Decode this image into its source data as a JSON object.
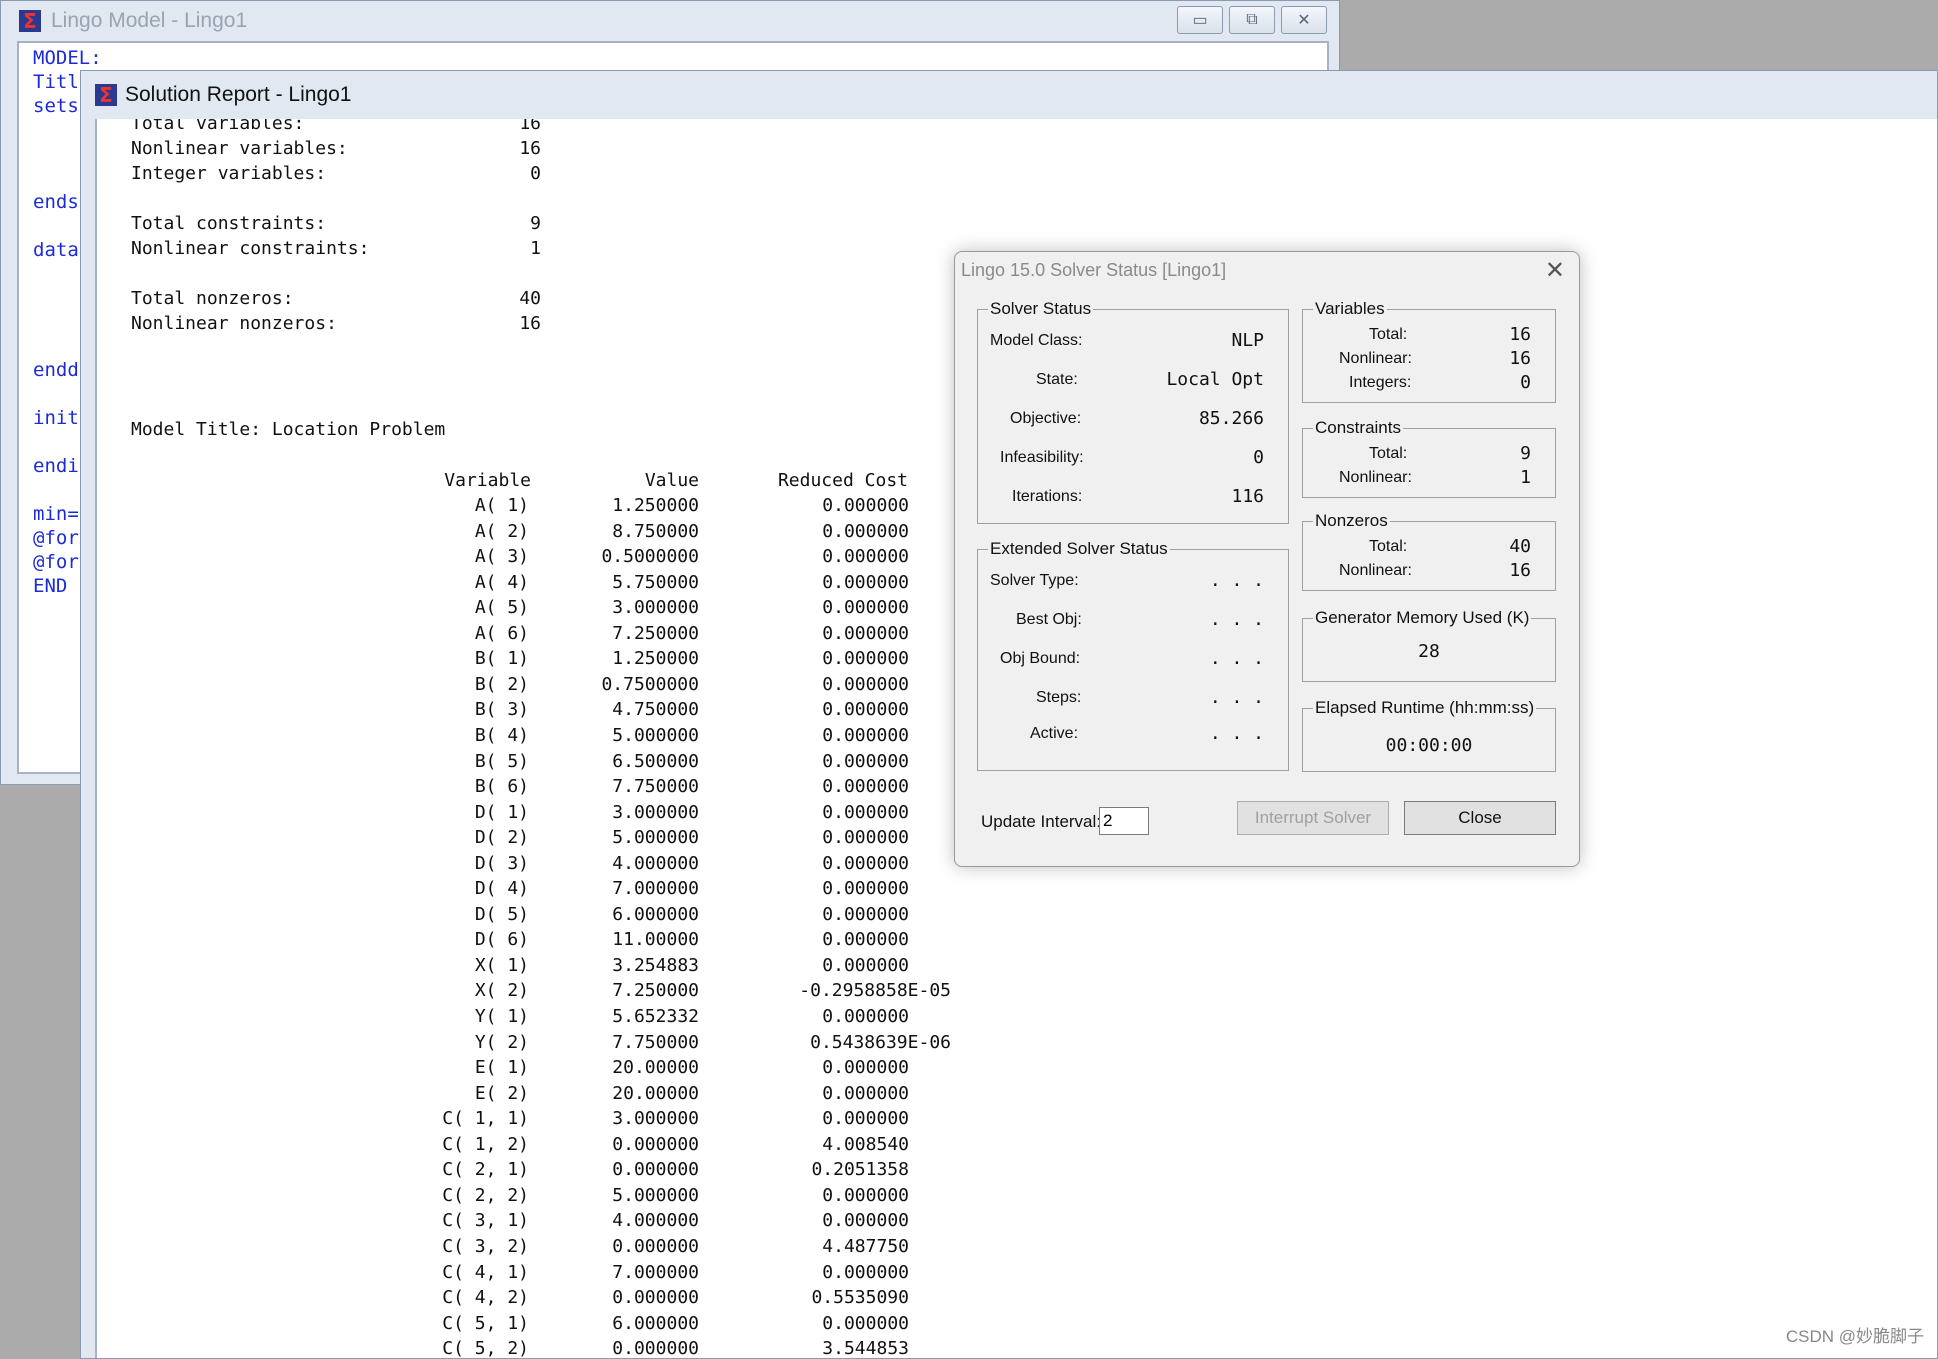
{
  "model_window": {
    "title": "Lingo Model - Lingo1",
    "code_lines": [
      "MODEL:",
      "Titl",
      "sets",
      "ends",
      "data",
      "endd",
      "init",
      "endi",
      "min=",
      "@for",
      "@for",
      "END"
    ]
  },
  "report_window": {
    "title": "Solution Report - Lingo1",
    "stats": [
      {
        "label": "Total variables:",
        "value": "16"
      },
      {
        "label": "Nonlinear variables:",
        "value": "16"
      },
      {
        "label": "Integer variables:",
        "value": "0"
      },
      {
        "label": "Total constraints:",
        "value": "9"
      },
      {
        "label": "Nonlinear constraints:",
        "value": "1"
      },
      {
        "label": "Total nonzeros:",
        "value": "40"
      },
      {
        "label": "Nonlinear nonzeros:",
        "value": "16"
      }
    ],
    "model_title_line": "Model Title: Location Problem",
    "table_headers": {
      "variable": "Variable",
      "value": "Value",
      "reduced_cost": "Reduced Cost"
    },
    "rows": [
      [
        "A( 1)",
        "1.250000",
        "0.000000"
      ],
      [
        "A( 2)",
        "8.750000",
        "0.000000"
      ],
      [
        "A( 3)",
        "0.5000000",
        "0.000000"
      ],
      [
        "A( 4)",
        "5.750000",
        "0.000000"
      ],
      [
        "A( 5)",
        "3.000000",
        "0.000000"
      ],
      [
        "A( 6)",
        "7.250000",
        "0.000000"
      ],
      [
        "B( 1)",
        "1.250000",
        "0.000000"
      ],
      [
        "B( 2)",
        "0.7500000",
        "0.000000"
      ],
      [
        "B( 3)",
        "4.750000",
        "0.000000"
      ],
      [
        "B( 4)",
        "5.000000",
        "0.000000"
      ],
      [
        "B( 5)",
        "6.500000",
        "0.000000"
      ],
      [
        "B( 6)",
        "7.750000",
        "0.000000"
      ],
      [
        "D( 1)",
        "3.000000",
        "0.000000"
      ],
      [
        "D( 2)",
        "5.000000",
        "0.000000"
      ],
      [
        "D( 3)",
        "4.000000",
        "0.000000"
      ],
      [
        "D( 4)",
        "7.000000",
        "0.000000"
      ],
      [
        "D( 5)",
        "6.000000",
        "0.000000"
      ],
      [
        "D( 6)",
        "11.00000",
        "0.000000"
      ],
      [
        "X( 1)",
        "3.254883",
        "0.000000"
      ],
      [
        "X( 2)",
        "7.250000",
        "-0.2958858E-05"
      ],
      [
        "Y( 1)",
        "5.652332",
        "0.000000"
      ],
      [
        "Y( 2)",
        "7.750000",
        "0.5438639E-06"
      ],
      [
        "E( 1)",
        "20.00000",
        "0.000000"
      ],
      [
        "E( 2)",
        "20.00000",
        "0.000000"
      ],
      [
        "C( 1, 1)",
        "3.000000",
        "0.000000"
      ],
      [
        "C( 1, 2)",
        "0.000000",
        "4.008540"
      ],
      [
        "C( 2, 1)",
        "0.000000",
        "0.2051358"
      ],
      [
        "C( 2, 2)",
        "5.000000",
        "0.000000"
      ],
      [
        "C( 3, 1)",
        "4.000000",
        "0.000000"
      ],
      [
        "C( 3, 2)",
        "0.000000",
        "4.487750"
      ],
      [
        "C( 4, 1)",
        "7.000000",
        "0.000000"
      ],
      [
        "C( 4, 2)",
        "0.000000",
        "0.5535090"
      ],
      [
        "C( 5, 1)",
        "6.000000",
        "0.000000"
      ],
      [
        "C( 5, 2)",
        "0.000000",
        "3.544853"
      ]
    ]
  },
  "solver_dialog": {
    "title": "Lingo 15.0 Solver Status [Lingo1]",
    "solver_status": {
      "group_title": "Solver Status",
      "model_class_label": "Model Class:",
      "model_class": "NLP",
      "state_label": "State:",
      "state": "Local Opt",
      "objective_label": "Objective:",
      "objective": "85.266",
      "infeasibility_label": "Infeasibility:",
      "infeasibility": "0",
      "iterations_label": "Iterations:",
      "iterations": "116"
    },
    "extended": {
      "group_title": "Extended Solver Status",
      "solver_type_label": "Solver Type:",
      "solver_type": ". . .",
      "best_obj_label": "Best Obj:",
      "best_obj": ". . .",
      "obj_bound_label": "Obj Bound:",
      "obj_bound": ". . .",
      "steps_label": "Steps:",
      "steps": ". . .",
      "active_label": "Active:",
      "active": ". . ."
    },
    "variables": {
      "group_title": "Variables",
      "total_label": "Total:",
      "total": "16",
      "nonlinear_label": "Nonlinear:",
      "nonlinear": "16",
      "integers_label": "Integers:",
      "integers": "0"
    },
    "constraints": {
      "group_title": "Constraints",
      "total_label": "Total:",
      "total": "9",
      "nonlinear_label": "Nonlinear:",
      "nonlinear": "1"
    },
    "nonzeros": {
      "group_title": "Nonzeros",
      "total_label": "Total:",
      "total": "40",
      "nonlinear_label": "Nonlinear:",
      "nonlinear": "16"
    },
    "memory": {
      "group_title": "Generator Memory Used (K)",
      "value": "28"
    },
    "runtime": {
      "group_title": "Elapsed Runtime (hh:mm:ss)",
      "value": "00:00:00"
    },
    "update_interval_label": "Update Interval:",
    "update_interval_value": "2",
    "interrupt_label": "Interrupt Solver",
    "close_label": "Close"
  },
  "watermark": "CSDN @妙脆脚子"
}
